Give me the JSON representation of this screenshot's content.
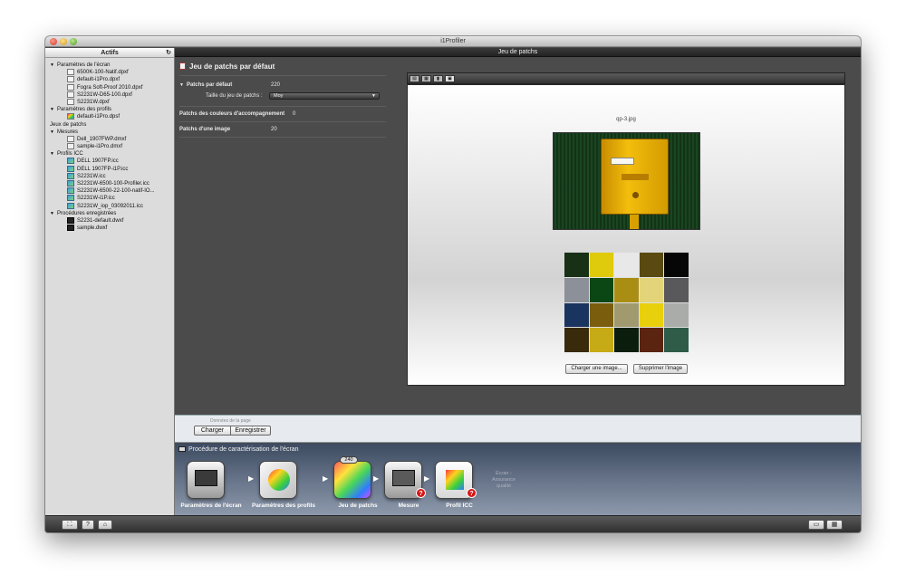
{
  "window": {
    "title": "i1Profiler"
  },
  "topbar": {
    "title": "Jeu de patchs"
  },
  "sidebar": {
    "header": "Actifs",
    "groups": [
      {
        "label": "Paramètres de l'écran",
        "items": [
          "6500K-100-Natif.dpxf",
          "default-i1Pro.dpxf",
          "Fogra Soft-Proof 2010.dpxf",
          "S2231W-D65-100.dpxf",
          "S2231W.dpxf"
        ]
      },
      {
        "label": "Paramètres des profils",
        "items": [
          "default-i1Pro.dpsf"
        ]
      },
      {
        "label": "Jeux de patchs",
        "items": []
      },
      {
        "label": "Mesures",
        "items": [
          "Dell_1907FWP.dmxf",
          "sample-i1Pro.dmxf"
        ]
      },
      {
        "label": "Profils ICC",
        "items": [
          "DELL 1907FP.icc",
          "DELL 1907FP-i1P.icc",
          "S2231W.icc",
          "S2231W-6500-100-Profiler.icc",
          "S2231W-6500-22-100-natif-IO...",
          "S2231W-i1P.icc",
          "S2231W_iop_03092011.icc"
        ]
      },
      {
        "label": "Procédures enregistrées",
        "items": [
          "S2231-default.dwxf",
          "sample.dwxf"
        ]
      }
    ]
  },
  "settings": {
    "title": "Jeu de patchs par défaut",
    "default_patches_label": "Patchs par défaut",
    "default_patches_value": "220",
    "patch_set_size_label": "Taille du jeu de patchs :",
    "patch_set_size_value": "Moy",
    "spot_colors_label": "Patchs des couleurs d'accompagnement",
    "spot_colors_value": "0",
    "image_patches_label": "Patchs d'une image",
    "image_patches_value": "20"
  },
  "preview": {
    "image_name": "qp-3.jpg",
    "load_button": "Charger une image...",
    "delete_button": "Supprimer l'image",
    "swatches": [
      "#173016",
      "#dfcb0c",
      "#e8e8e8",
      "#5a4a12",
      "#060606",
      "#8c9098",
      "#0a4714",
      "#aa8e14",
      "#e3d47a",
      "#59595b",
      "#1a3460",
      "#7a5e0e",
      "#a09a6e",
      "#e8d00c",
      "#a9aca8",
      "#3a2a0c",
      "#c6aa16",
      "#0b1e0d",
      "#5a2410",
      "#2e5c48"
    ]
  },
  "page_data": {
    "caption": "Données de la page",
    "load_button": "Charger",
    "save_button": "Enregistrer"
  },
  "workflow": {
    "title": "Procédure de caractérisation de l'écran",
    "steps": [
      {
        "label": "Paramètres de l'écran"
      },
      {
        "label": "Paramètres des profils"
      },
      {
        "label": "Jeu de patchs",
        "count": "240"
      },
      {
        "label": "Mesure"
      },
      {
        "label": "Profil ICC"
      }
    ],
    "extra_line1": "Écran -",
    "extra_line2": "Assurance",
    "extra_line3": "qualité"
  },
  "bottombar": {
    "help_label": "?"
  }
}
